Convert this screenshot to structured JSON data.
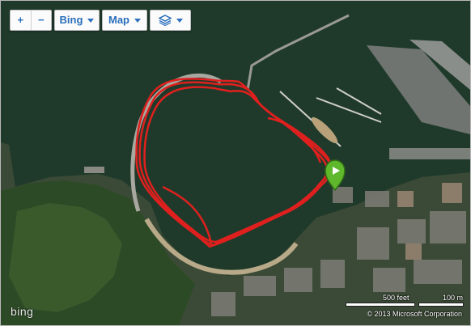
{
  "toolbar": {
    "zoom_in": "+",
    "zoom_out": "−",
    "source_label": "Bing",
    "view_label": "Map",
    "layers_icon": "layers-icon"
  },
  "scale": {
    "large": "500 feet",
    "small": "100 m"
  },
  "copyright": "© 2013 Microsoft Corporation",
  "logo": "bing",
  "colors": {
    "water": "#1f3a2b",
    "track": "#e0201e",
    "marker": "#5fb72b",
    "control_text": "#2a6fbc"
  }
}
